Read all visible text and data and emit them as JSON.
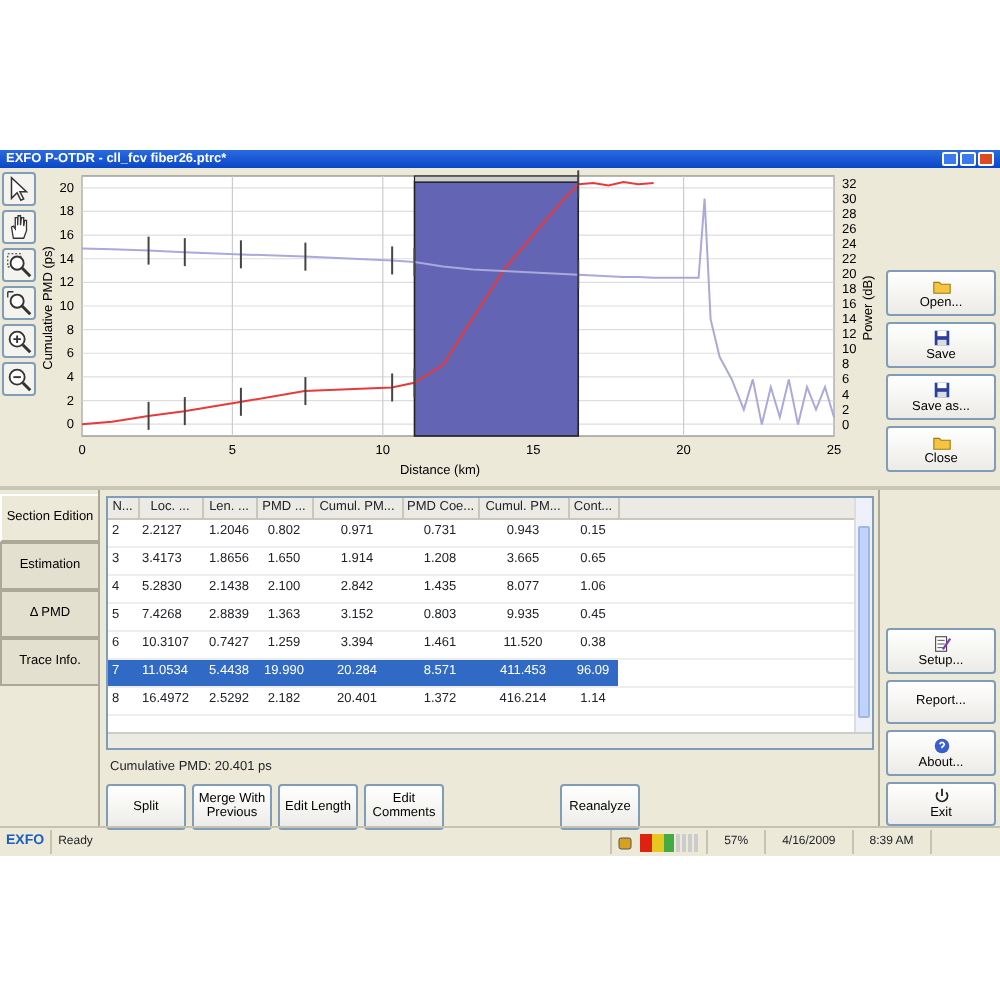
{
  "window": {
    "title": "EXFO P-OTDR - cll_fcv fiber26.ptrc*"
  },
  "chart": {
    "chart_data": {
      "type": "line",
      "grid": true,
      "xlabel": "Distance (km)",
      "ylabel": "Cumulative PMD (ps)",
      "y2label": "Power (dB)",
      "xlim": [
        0,
        25
      ],
      "ylim": [
        -1,
        21
      ],
      "y2lim": [
        -1.5,
        33
      ],
      "xticks": [
        0,
        5,
        10,
        15,
        20,
        25
      ],
      "yticks": [
        0,
        2,
        4,
        6,
        8,
        10,
        12,
        14,
        16,
        18,
        20
      ],
      "y2ticks": [
        0,
        2,
        4,
        6,
        8,
        10,
        12,
        14,
        16,
        18,
        20,
        22,
        24,
        26,
        28,
        30,
        32
      ],
      "x": [
        0,
        1,
        2.2,
        3.4,
        5.3,
        7.4,
        10.3,
        11.05,
        12,
        13,
        14,
        15,
        16,
        16.5,
        17,
        17.5,
        18,
        18.5,
        19,
        20.5,
        20.7,
        20.9,
        21.2,
        21.6,
        22,
        22.3,
        22.6,
        22.9,
        23.2,
        23.5,
        23.8,
        24.1,
        24.4,
        24.7,
        25
      ],
      "series": [
        {
          "color": "#e83a3a",
          "axis": "y",
          "values": [
            0,
            0.2,
            0.7,
            1.1,
            1.9,
            2.8,
            3.1,
            3.5,
            5,
            9,
            13,
            16,
            19,
            20.3,
            20.4,
            20.2,
            20.5,
            20.3,
            20.4,
            null,
            null,
            null,
            null,
            null,
            null,
            null,
            null,
            null,
            null,
            null,
            null,
            null,
            null,
            null,
            null
          ]
        },
        {
          "color": "#a9a9dc",
          "axis": "y2",
          "values": [
            23.4,
            23.3,
            23.1,
            22.9,
            22.6,
            22.3,
            21.8,
            21.6,
            21,
            20.6,
            20.4,
            20.2,
            20,
            19.9,
            19.8,
            19.7,
            19.6,
            19.6,
            19.5,
            19.5,
            30,
            14,
            9,
            6,
            2,
            6,
            0,
            5,
            1,
            6,
            0,
            5,
            2,
            5,
            1
          ]
        }
      ]
    }
  },
  "right_buttons_top": [
    "Open...",
    "Save",
    "Save as...",
    "Close"
  ],
  "side_tabs": [
    {
      "label": "Section Edition",
      "selected": true
    },
    {
      "label": "Estimation",
      "selected": false
    },
    {
      "label": "Δ PMD",
      "selected": false
    },
    {
      "label": "Trace Info.",
      "selected": false
    }
  ],
  "table": {
    "columns": [
      "N...",
      "Loc. ...",
      "Len. ...",
      "PMD ...",
      "Cumul. PM...",
      "PMD Coe...",
      "Cumul. PM...",
      "Cont..."
    ],
    "rows": [
      {
        "cells": [
          "2",
          "2.2127",
          "1.2046",
          "0.802",
          "0.971",
          "0.731",
          "0.943",
          "0.15"
        ],
        "selected": false
      },
      {
        "cells": [
          "3",
          "3.4173",
          "1.8656",
          "1.650",
          "1.914",
          "1.208",
          "3.665",
          "0.65"
        ],
        "selected": false
      },
      {
        "cells": [
          "4",
          "5.2830",
          "2.1438",
          "2.100",
          "2.842",
          "1.435",
          "8.077",
          "1.06"
        ],
        "selected": false
      },
      {
        "cells": [
          "5",
          "7.4268",
          "2.8839",
          "1.363",
          "3.152",
          "0.803",
          "9.935",
          "0.45"
        ],
        "selected": false
      },
      {
        "cells": [
          "6",
          "10.3107",
          "0.7427",
          "1.259",
          "3.394",
          "1.461",
          "11.520",
          "0.38"
        ],
        "selected": false
      },
      {
        "cells": [
          "7",
          "11.0534",
          "5.4438",
          "19.990",
          "20.284",
          "8.571",
          "411.453",
          "96.09"
        ],
        "selected": true
      },
      {
        "cells": [
          "8",
          "16.4972",
          "2.5292",
          "2.182",
          "20.401",
          "1.372",
          "416.214",
          "1.14"
        ],
        "selected": false
      }
    ]
  },
  "cumulative_pmd": "Cumulative PMD: 20.401 ps",
  "action_buttons": [
    "Split",
    "Merge With Previous",
    "Edit Length",
    "Edit Comments"
  ],
  "reanalyze_button": "Reanalyze",
  "right_buttons_bottom": [
    "Setup...",
    "Report...",
    "About...",
    "Exit"
  ],
  "status_bar": {
    "logo": "EXFO",
    "status": "Ready",
    "signal": {
      "level": 0.57
    },
    "percent": "57%",
    "date": "4/16/2009",
    "time": "8:39 AM"
  }
}
